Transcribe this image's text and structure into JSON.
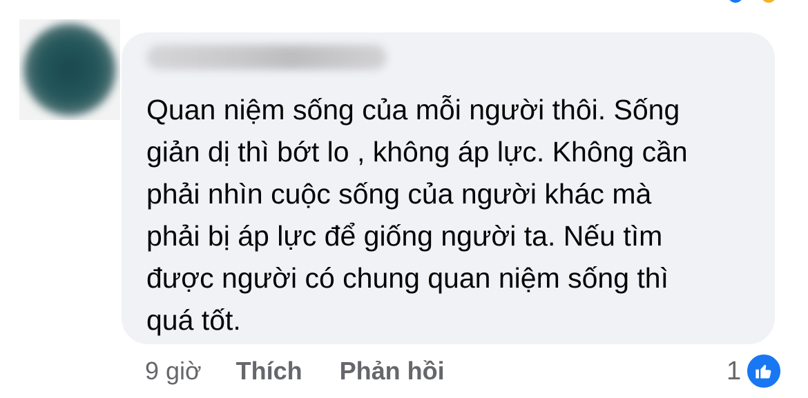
{
  "comment": {
    "text_lines": [
      "Quan niệm sống của mỗi người thôi. Sống",
      "giản dị thì bớt lo , không áp lực. Không cần",
      "phải nhìn cuộc sống của người khác mà",
      "phải bị áp lực để giống người ta. Nếu tìm",
      "được người có chung quan niệm sống thì",
      "quá tốt."
    ],
    "line_1": "Quan niệm sống của mỗi người thôi. Sống",
    "line_2": "giản dị thì bớt lo , không áp lực. Không cần",
    "line_3": "phải nhìn cuộc sống của người khác mà",
    "line_4": "phải bị áp lực để giống người ta. Nếu tìm",
    "line_5": "được người có chung quan niệm sống thì",
    "line_6": "quá tốt."
  },
  "meta": {
    "time": "9 giờ",
    "like_label": "Thích",
    "reply_label": "Phản hồi"
  },
  "reactions": {
    "count": "1",
    "icon": "thumbs-up-icon"
  },
  "colors": {
    "bubble_bg": "#f0f2f5",
    "text": "#050505",
    "secondary_text": "#65676b",
    "like_blue": "#1877f2"
  }
}
